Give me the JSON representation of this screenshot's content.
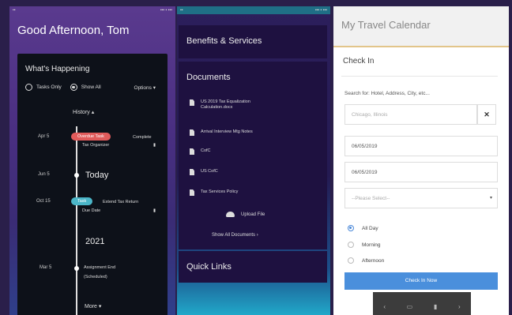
{
  "phone1": {
    "greeting": "Good Afternoon, Tom",
    "card_title": "What's Happening",
    "filters": {
      "tasks_only": "Tasks Only",
      "show_all": "Show All",
      "options": "Options ▾"
    },
    "history": "History ▴",
    "timeline": {
      "apr_date": "Apr 5",
      "apr_pill": "Overdue Task",
      "apr_status": "Complete",
      "apr_text": "Tax Organizer",
      "jun_date": "Jun 5",
      "today": "Today",
      "oct_date": "Oct 15",
      "oct_pill": "Task",
      "oct_text": "Extend Tax Return",
      "oct_sub": "Due Date",
      "year": "2021",
      "mar_date": "Mar 5",
      "mar_text": "Assignment End",
      "mar_sub": "(Scheduled)"
    },
    "more": "More ▾"
  },
  "phone2": {
    "benefits": "Benefits & Services",
    "documents": "Documents",
    "docs": [
      {
        "name": "US 2019 Tax Equalization Calculation.docx"
      },
      {
        "name": "Arrival Interview Mtg Notes"
      },
      {
        "name": "CofC"
      },
      {
        "name": "US CofC"
      },
      {
        "name": "Tax Services Policy"
      }
    ],
    "upload": "Upload File",
    "show_all": "Show All Documents ›",
    "quick_links": "Quick Links"
  },
  "phone3": {
    "title": "My Travel Calendar",
    "check_in": "Check In",
    "search_label": "Search for: Hotel, Address, City, etc...",
    "search_value": "Chicago, Illinois",
    "clear": "✕",
    "date1": "06/05/2019",
    "date2": "06/05/2019",
    "select_placeholder": "--Please Select--",
    "select_arrow": "▾",
    "options": [
      {
        "label": "All Day"
      },
      {
        "label": "Morning"
      },
      {
        "label": "Afternoon"
      }
    ],
    "button": "Check In Now",
    "nav": {
      "back": "‹",
      "home": "▭",
      "trash": "▮",
      "forward": "›"
    }
  }
}
